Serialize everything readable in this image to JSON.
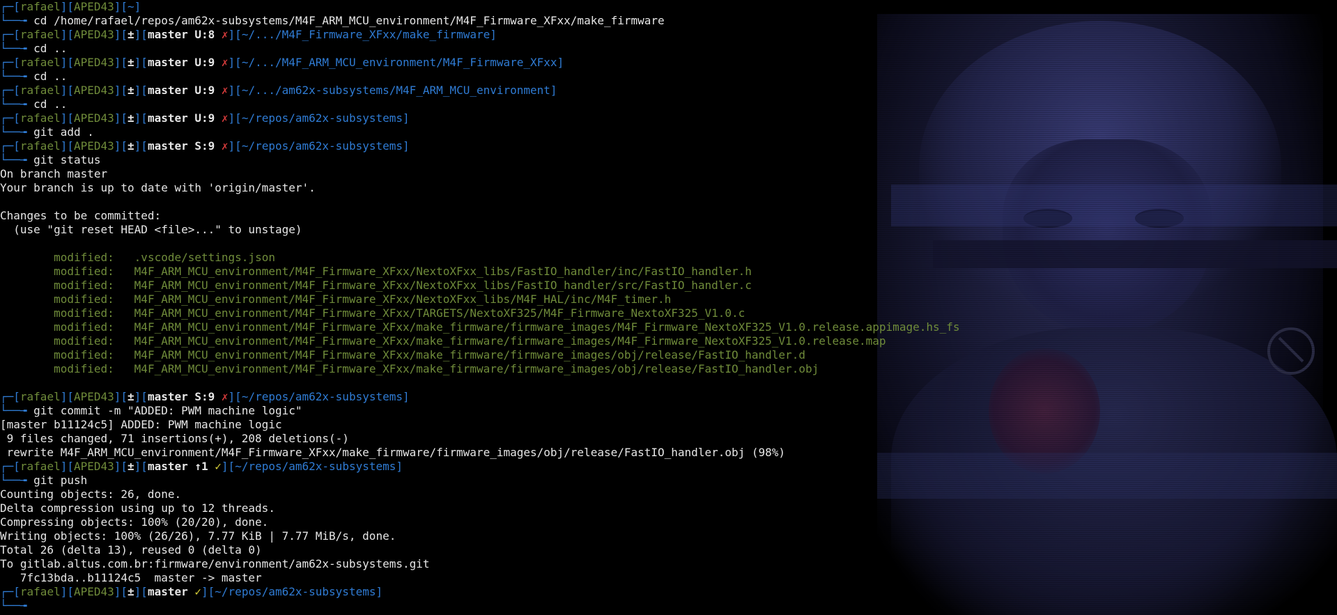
{
  "window": {
    "app": "terminal"
  },
  "colors": {
    "background": "#000000",
    "prompt_blue": "#2f7bd3",
    "prompt_green": "#6f8b3a",
    "dirty_red": "#d23a3a",
    "clean_yellow": "#d9d23a",
    "text": "#e6e6e6"
  },
  "lines": [
    {
      "t": "p",
      "user": "rafael",
      "host": "APED43",
      "path": "~",
      "vcs": false
    },
    {
      "t": "cmd",
      "text": "cd /home/rafael/repos/am62x-subsystems/M4F_ARM_MCU_environment/M4F_Firmware_XFxx/make_firmware"
    },
    {
      "t": "p",
      "user": "rafael",
      "host": "APED43",
      "pm": "±",
      "branch": "master U:8",
      "mark": "✗",
      "path": "~/.../M4F_Firmware_XFxx/make_firmware",
      "vcs": true
    },
    {
      "t": "cmd",
      "text": "cd .."
    },
    {
      "t": "p",
      "user": "rafael",
      "host": "APED43",
      "pm": "±",
      "branch": "master U:9",
      "mark": "✗",
      "path": "~/.../M4F_ARM_MCU_environment/M4F_Firmware_XFxx",
      "vcs": true
    },
    {
      "t": "cmd",
      "text": "cd .."
    },
    {
      "t": "p",
      "user": "rafael",
      "host": "APED43",
      "pm": "±",
      "branch": "master U:9",
      "mark": "✗",
      "path": "~/.../am62x-subsystems/M4F_ARM_MCU_environment",
      "vcs": true
    },
    {
      "t": "cmd",
      "text": "cd .."
    },
    {
      "t": "p",
      "user": "rafael",
      "host": "APED43",
      "pm": "±",
      "branch": "master U:9",
      "mark": "✗",
      "path": "~/repos/am62x-subsystems",
      "vcs": true
    },
    {
      "t": "cmd",
      "text": "git add ."
    },
    {
      "t": "p",
      "user": "rafael",
      "host": "APED43",
      "pm": "±",
      "branch": "master S:9",
      "mark": "✗",
      "path": "~/repos/am62x-subsystems",
      "vcs": true
    },
    {
      "t": "cmd",
      "text": "git status"
    },
    {
      "t": "out",
      "text": "On branch master"
    },
    {
      "t": "out",
      "text": "Your branch is up to date with 'origin/master'."
    },
    {
      "t": "out",
      "text": ""
    },
    {
      "t": "out",
      "text": "Changes to be committed:"
    },
    {
      "t": "out",
      "text": "  (use \"git reset HEAD <file>...\" to unstage)"
    },
    {
      "t": "out",
      "text": ""
    },
    {
      "t": "mod",
      "label": "modified:",
      "file": ".vscode/settings.json"
    },
    {
      "t": "mod",
      "label": "modified:",
      "file": "M4F_ARM_MCU_environment/M4F_Firmware_XFxx/NextoXFxx_libs/FastIO_handler/inc/FastIO_handler.h"
    },
    {
      "t": "mod",
      "label": "modified:",
      "file": "M4F_ARM_MCU_environment/M4F_Firmware_XFxx/NextoXFxx_libs/FastIO_handler/src/FastIO_handler.c"
    },
    {
      "t": "mod",
      "label": "modified:",
      "file": "M4F_ARM_MCU_environment/M4F_Firmware_XFxx/NextoXFxx_libs/M4F_HAL/inc/M4F_timer.h"
    },
    {
      "t": "mod",
      "label": "modified:",
      "file": "M4F_ARM_MCU_environment/M4F_Firmware_XFxx/TARGETS/NextoXF325/M4F_Firmware_NextoXF325_V1.0.c"
    },
    {
      "t": "mod",
      "label": "modified:",
      "file": "M4F_ARM_MCU_environment/M4F_Firmware_XFxx/make_firmware/firmware_images/M4F_Firmware_NextoXF325_V1.0.release.appimage.hs_fs"
    },
    {
      "t": "mod",
      "label": "modified:",
      "file": "M4F_ARM_MCU_environment/M4F_Firmware_XFxx/make_firmware/firmware_images/M4F_Firmware_NextoXF325_V1.0.release.map"
    },
    {
      "t": "mod",
      "label": "modified:",
      "file": "M4F_ARM_MCU_environment/M4F_Firmware_XFxx/make_firmware/firmware_images/obj/release/FastIO_handler.d"
    },
    {
      "t": "mod",
      "label": "modified:",
      "file": "M4F_ARM_MCU_environment/M4F_Firmware_XFxx/make_firmware/firmware_images/obj/release/FastIO_handler.obj"
    },
    {
      "t": "out",
      "text": ""
    },
    {
      "t": "p",
      "user": "rafael",
      "host": "APED43",
      "pm": "±",
      "branch": "master S:9",
      "mark": "✗",
      "path": "~/repos/am62x-subsystems",
      "vcs": true
    },
    {
      "t": "cmd",
      "text": "git commit -m \"ADDED: PWM machine logic\""
    },
    {
      "t": "out",
      "text": "[master b11124c5] ADDED: PWM machine logic"
    },
    {
      "t": "out",
      "text": " 9 files changed, 71 insertions(+), 208 deletions(-)"
    },
    {
      "t": "out",
      "text": " rewrite M4F_ARM_MCU_environment/M4F_Firmware_XFxx/make_firmware/firmware_images/obj/release/FastIO_handler.obj (98%)"
    },
    {
      "t": "p",
      "user": "rafael",
      "host": "APED43",
      "pm": "±",
      "branch": "master ↑1",
      "mark": "✓",
      "path": "~/repos/am62x-subsystems",
      "vcs": true,
      "clean": true
    },
    {
      "t": "cmd",
      "text": "git push"
    },
    {
      "t": "out",
      "text": "Counting objects: 26, done."
    },
    {
      "t": "out",
      "text": "Delta compression using up to 12 threads."
    },
    {
      "t": "out",
      "text": "Compressing objects: 100% (20/20), done."
    },
    {
      "t": "out",
      "text": "Writing objects: 100% (26/26), 7.77 KiB | 7.77 MiB/s, done."
    },
    {
      "t": "out",
      "text": "Total 26 (delta 13), reused 0 (delta 0)"
    },
    {
      "t": "out",
      "text": "To gitlab.altus.com.br:firmware/environment/am62x-subsystems.git"
    },
    {
      "t": "out",
      "text": "   7fc13bda..b11124c5  master -> master"
    },
    {
      "t": "p",
      "user": "rafael",
      "host": "APED43",
      "pm": "±",
      "branch": "master",
      "mark": "✓",
      "path": "~/repos/am62x-subsystems",
      "vcs": true,
      "clean": true
    },
    {
      "t": "cmd",
      "text": ""
    }
  ],
  "glyphs": {
    "prompt_top": "┌─",
    "prompt_bottom": "└──╼ ",
    "mod_indent": "        ",
    "mod_gap": "   "
  }
}
